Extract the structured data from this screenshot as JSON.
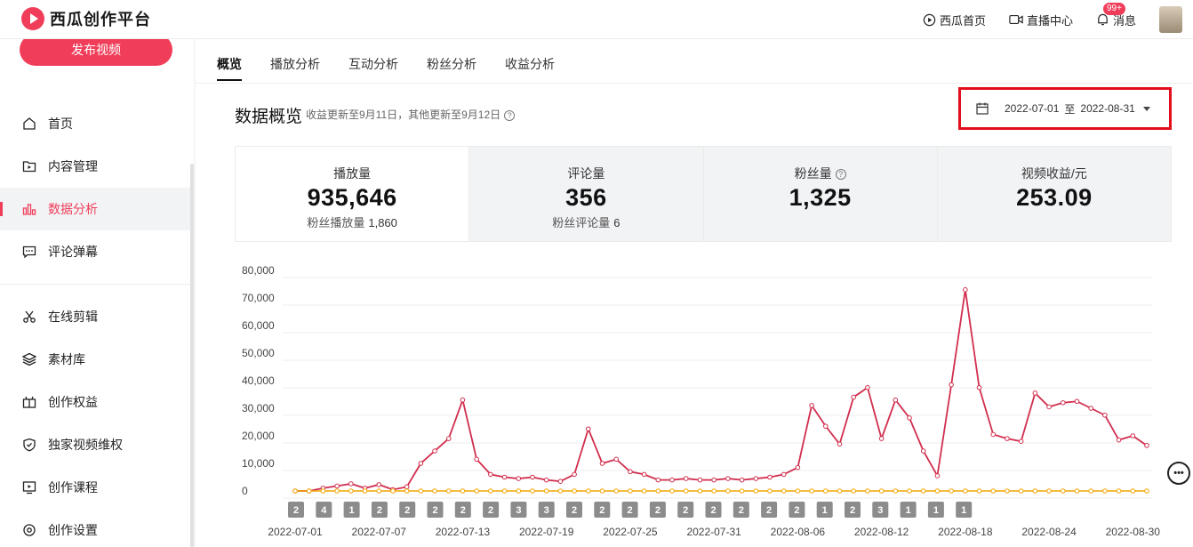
{
  "header": {
    "logo_text": "西瓜创作平台",
    "links": [
      {
        "label": "西瓜首页",
        "icon": "play-circle-icon"
      },
      {
        "label": "直播中心",
        "icon": "video-camera-icon"
      },
      {
        "label": "消息",
        "icon": "bell-icon",
        "badge": "99+"
      }
    ]
  },
  "sidebar": {
    "publish_label": "发布视频",
    "items": [
      {
        "label": "首页",
        "icon": "home-icon"
      },
      {
        "label": "内容管理",
        "icon": "folder-play-icon"
      },
      {
        "label": "数据分析",
        "icon": "bar-chart-icon",
        "active": true
      },
      {
        "label": "评论弹幕",
        "icon": "comment-icon"
      },
      {
        "label": "在线剪辑",
        "icon": "scissors-icon"
      },
      {
        "label": "素材库",
        "icon": "layers-icon"
      },
      {
        "label": "创作权益",
        "icon": "gift-icon"
      },
      {
        "label": "独家视频维权",
        "icon": "shield-icon"
      },
      {
        "label": "创作课程",
        "icon": "course-icon"
      },
      {
        "label": "创作设置",
        "icon": "settings-icon"
      }
    ]
  },
  "tabs": [
    "概览",
    "播放分析",
    "互动分析",
    "粉丝分析",
    "收益分析"
  ],
  "overview": {
    "title": "数据概览",
    "subtitle": "收益更新至9月11日，其他更新至9月12日",
    "help": "?",
    "date_start": "2022-07-01",
    "date_to": "至",
    "date_end": "2022-08-31"
  },
  "metrics": [
    {
      "label": "播放量",
      "value": "935,646",
      "sub_label": "粉丝播放量",
      "sub_value": "1,860",
      "active": true
    },
    {
      "label": "评论量",
      "value": "356",
      "sub_label": "粉丝评论量",
      "sub_value": "6"
    },
    {
      "label": "粉丝量",
      "value": "1,325",
      "help": "?"
    },
    {
      "label": "视频收益/元",
      "value": "253.09"
    }
  ],
  "chart_data": {
    "type": "line",
    "ylim": [
      0,
      80000
    ],
    "y_ticks": [
      "80,000",
      "70,000",
      "60,000",
      "50,000",
      "40,000",
      "30,000",
      "20,000",
      "10,000",
      "0"
    ],
    "x_tick_labels": [
      "2022-07-01",
      "2022-07-07",
      "2022-07-13",
      "2022-07-19",
      "2022-07-25",
      "2022-07-31",
      "2022-08-06",
      "2022-08-12",
      "2022-08-18",
      "2022-08-24",
      "2022-08-30"
    ],
    "x_count": 62,
    "series": [
      {
        "color": "#d12e4d",
        "values": [
          0,
          0,
          1000,
          1800,
          2600,
          1000,
          2300,
          500,
          1500,
          10000,
          14500,
          19000,
          33000,
          11500,
          6000,
          5000,
          4500,
          5000,
          4000,
          3500,
          6000,
          22500,
          10000,
          11500,
          7000,
          6000,
          4000,
          4000,
          4500,
          4000,
          4000,
          4500,
          4000,
          4500,
          5000,
          6000,
          8500,
          31000,
          23500,
          17000,
          34000,
          37500,
          19000,
          33000,
          26500,
          14500,
          5500,
          38500,
          73000,
          37500,
          20500,
          19000,
          18000,
          35500,
          30500,
          32000,
          32500,
          30000,
          27500,
          18500,
          20000,
          16500
        ]
      },
      {
        "color": "#f0a500",
        "values": [
          0,
          0,
          0,
          0,
          0,
          0,
          0,
          0,
          0,
          0,
          0,
          0,
          0,
          0,
          0,
          0,
          0,
          0,
          0,
          0,
          0,
          0,
          0,
          0,
          0,
          0,
          0,
          0,
          0,
          0,
          0,
          0,
          0,
          0,
          0,
          0,
          0,
          0,
          0,
          0,
          0,
          0,
          0,
          0,
          0,
          0,
          0,
          0,
          0,
          0,
          0,
          0,
          0,
          0,
          0,
          0,
          0,
          0,
          0,
          0,
          0,
          0
        ]
      }
    ],
    "markers": [
      {
        "x": 0,
        "label": "2"
      },
      {
        "x": 1,
        "label": "4"
      },
      {
        "x": 2,
        "label": "1"
      },
      {
        "x": 3,
        "label": "2"
      },
      {
        "x": 4,
        "label": "2"
      },
      {
        "x": 5,
        "label": "2"
      },
      {
        "x": 6,
        "label": "2"
      },
      {
        "x": 7,
        "label": "2"
      },
      {
        "x": 8,
        "label": "3"
      },
      {
        "x": 9,
        "label": "3"
      },
      {
        "x": 10,
        "label": "2"
      },
      {
        "x": 11,
        "label": "2"
      },
      {
        "x": 12,
        "label": "2"
      },
      {
        "x": 13,
        "label": "2"
      },
      {
        "x": 14,
        "label": "2"
      },
      {
        "x": 15,
        "label": "2"
      },
      {
        "x": 16,
        "label": "2"
      },
      {
        "x": 17,
        "label": "2"
      },
      {
        "x": 18,
        "label": "2"
      },
      {
        "x": 19,
        "label": "1"
      },
      {
        "x": 20,
        "label": "2"
      },
      {
        "x": 21,
        "label": "3"
      },
      {
        "x": 22,
        "label": "1"
      },
      {
        "x": 23,
        "label": "1"
      },
      {
        "x": 24,
        "label": "1"
      }
    ]
  }
}
